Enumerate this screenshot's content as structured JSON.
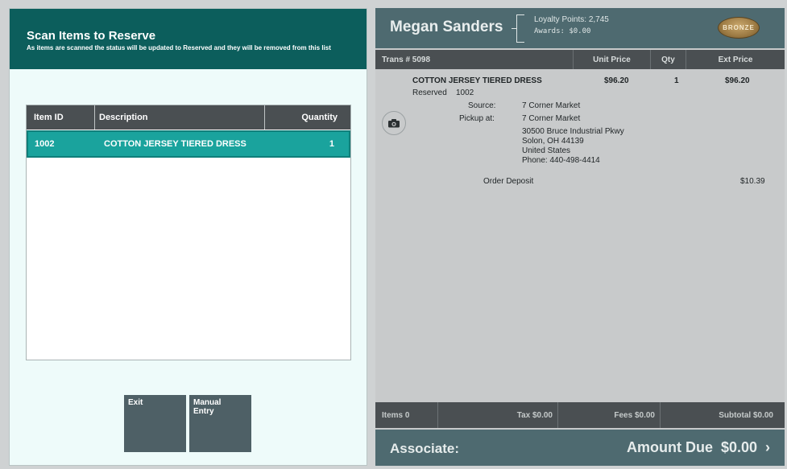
{
  "left_panel": {
    "title": "Scan Items to Reserve",
    "subtitle": "As items are scanned the status will be updated to Reserved and they will be removed from this list",
    "table": {
      "columns": [
        "Item ID",
        "Description",
        "Quantity"
      ],
      "rows": [
        {
          "item_id": "1002",
          "description": "COTTON JERSEY TIERED DRESS",
          "quantity": "1"
        }
      ]
    },
    "buttons": {
      "exit": "Exit",
      "manual_entry": "Manual\nEntry"
    }
  },
  "customer": {
    "name": "Megan Sanders",
    "loyalty_points": "Loyalty Points: 2,745",
    "awards": "Awards: $0.00",
    "tier_badge": "BRONZE",
    "tier_color": "#9c7a43"
  },
  "transaction": {
    "columns": {
      "trans": "Trans # 5098",
      "unit_price": "Unit Price",
      "qty": "Qty",
      "ext_price": "Ext Price"
    },
    "line": {
      "description": "COTTON JERSEY TIERED DRESS",
      "unit_price": "$96.20",
      "qty": "1",
      "ext_price": "$96.20",
      "status": "Reserved",
      "item_id": "1002",
      "source_label": "Source:",
      "source_value": "7 Corner Market",
      "pickup_label": "Pickup at:",
      "pickup_name": "7 Corner Market",
      "pickup_address1": "30500 Bruce Industrial Pkwy",
      "pickup_address2": "Solon, OH 44139",
      "pickup_country": "United States",
      "pickup_phone": "Phone: 440-498-4414",
      "camera_icon": "camera-icon"
    },
    "deposit_label": "Order Deposit",
    "deposit_value": "$10.39"
  },
  "totals": {
    "items": "Items 0",
    "tax": "Tax $0.00",
    "fees": "Fees $0.00",
    "subtotal": "Subtotal $0.00"
  },
  "footer": {
    "associate": "Associate:",
    "amount_due": "Amount Due  $0.00  ›"
  },
  "colors": {
    "header_teal": "#0c5e5c",
    "selected_row": "#1aa39d",
    "slate": "#4e6a70"
  }
}
